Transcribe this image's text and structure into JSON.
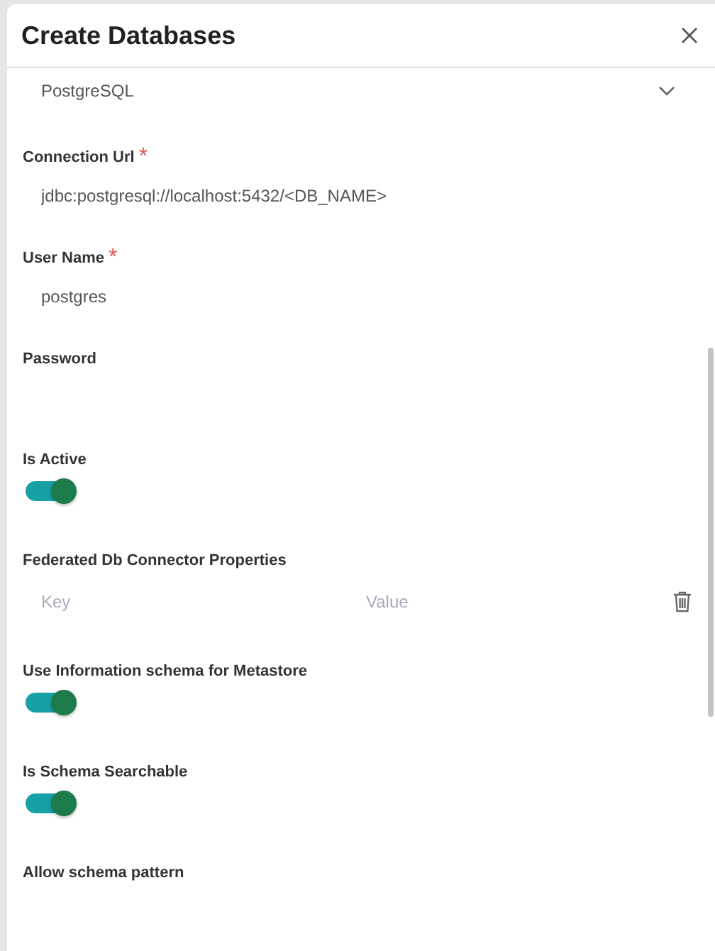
{
  "dialog": {
    "title": "Create Databases"
  },
  "fields": [
    {
      "kind": "select",
      "value": "PostgreSQL"
    },
    {
      "kind": "text",
      "label": "Connection Url",
      "required_mark": "*",
      "value": "jdbc:postgresql://localhost:5432/<DB_NAME>"
    },
    {
      "kind": "text",
      "label": "User Name",
      "required_mark": "*",
      "value": "postgres"
    },
    {
      "kind": "password",
      "label": "Password"
    },
    {
      "kind": "toggle",
      "label": "Is Active",
      "on": true
    },
    {
      "kind": "keyvalue",
      "label": "Federated Db Connector Properties",
      "key_placeholder": "Key",
      "value_placeholder": "Value"
    },
    {
      "kind": "toggle",
      "label": "Use Information schema for Metastore",
      "on": true
    },
    {
      "kind": "toggle",
      "label": "Is Schema Searchable",
      "on": true
    },
    {
      "kind": "text",
      "label": "Allow schema pattern"
    }
  ]
}
